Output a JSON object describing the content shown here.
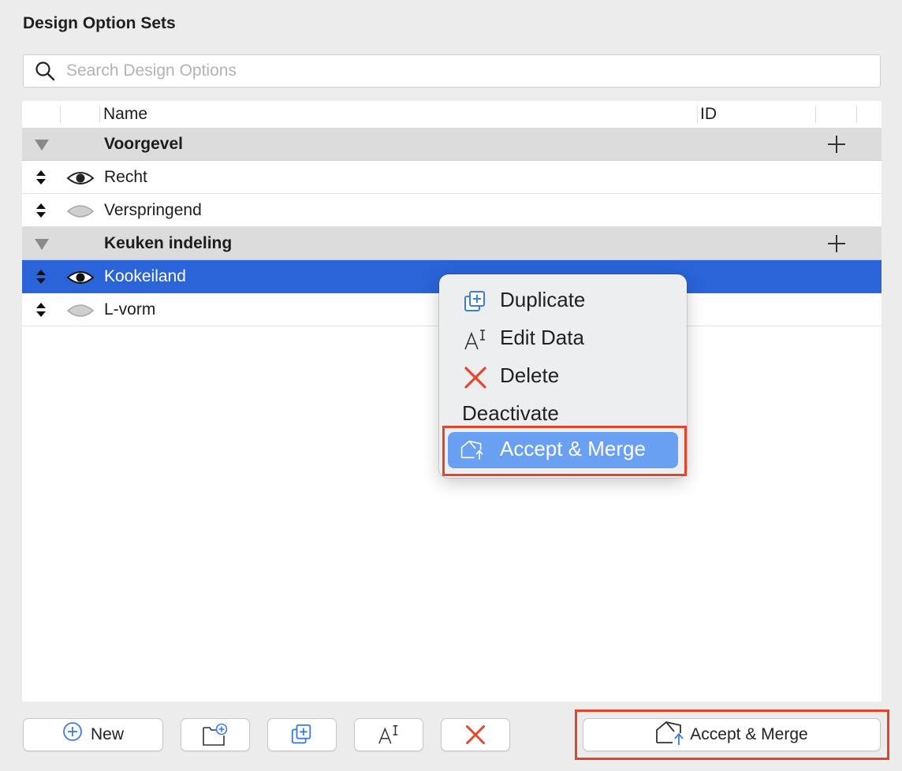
{
  "panel": {
    "title": "Design Option Sets"
  },
  "search": {
    "placeholder": "Search Design Options"
  },
  "table": {
    "columns": {
      "name": "Name",
      "id": "ID"
    },
    "groups": [
      {
        "name": "Voorgevel",
        "options": [
          {
            "name": "Recht",
            "visible": true,
            "selected": false
          },
          {
            "name": "Verspringend",
            "visible": false,
            "selected": false
          }
        ]
      },
      {
        "name": "Keuken indeling",
        "options": [
          {
            "name": "Kookeiland",
            "visible": true,
            "selected": true
          },
          {
            "name": "L-vorm",
            "visible": false,
            "selected": false
          }
        ]
      }
    ]
  },
  "context_menu": {
    "items": [
      {
        "label": "Duplicate",
        "icon": "duplicate-icon"
      },
      {
        "label": "Edit Data",
        "icon": "edit-data-icon"
      },
      {
        "label": "Delete",
        "icon": "delete-x-icon"
      },
      {
        "label": "Deactivate",
        "icon": ""
      },
      {
        "label": "Accept & Merge",
        "icon": "accept-merge-icon",
        "highlighted": true
      }
    ]
  },
  "toolbar": {
    "new_label": "New",
    "accept_merge_label": "Accept & Merge"
  },
  "colors": {
    "selection": "#2a64d8",
    "menu_highlight": "#6aa0f2",
    "annotation_box": "#e2452a",
    "delete_red": "#e5462c",
    "accent_blue": "#3b7de0"
  }
}
